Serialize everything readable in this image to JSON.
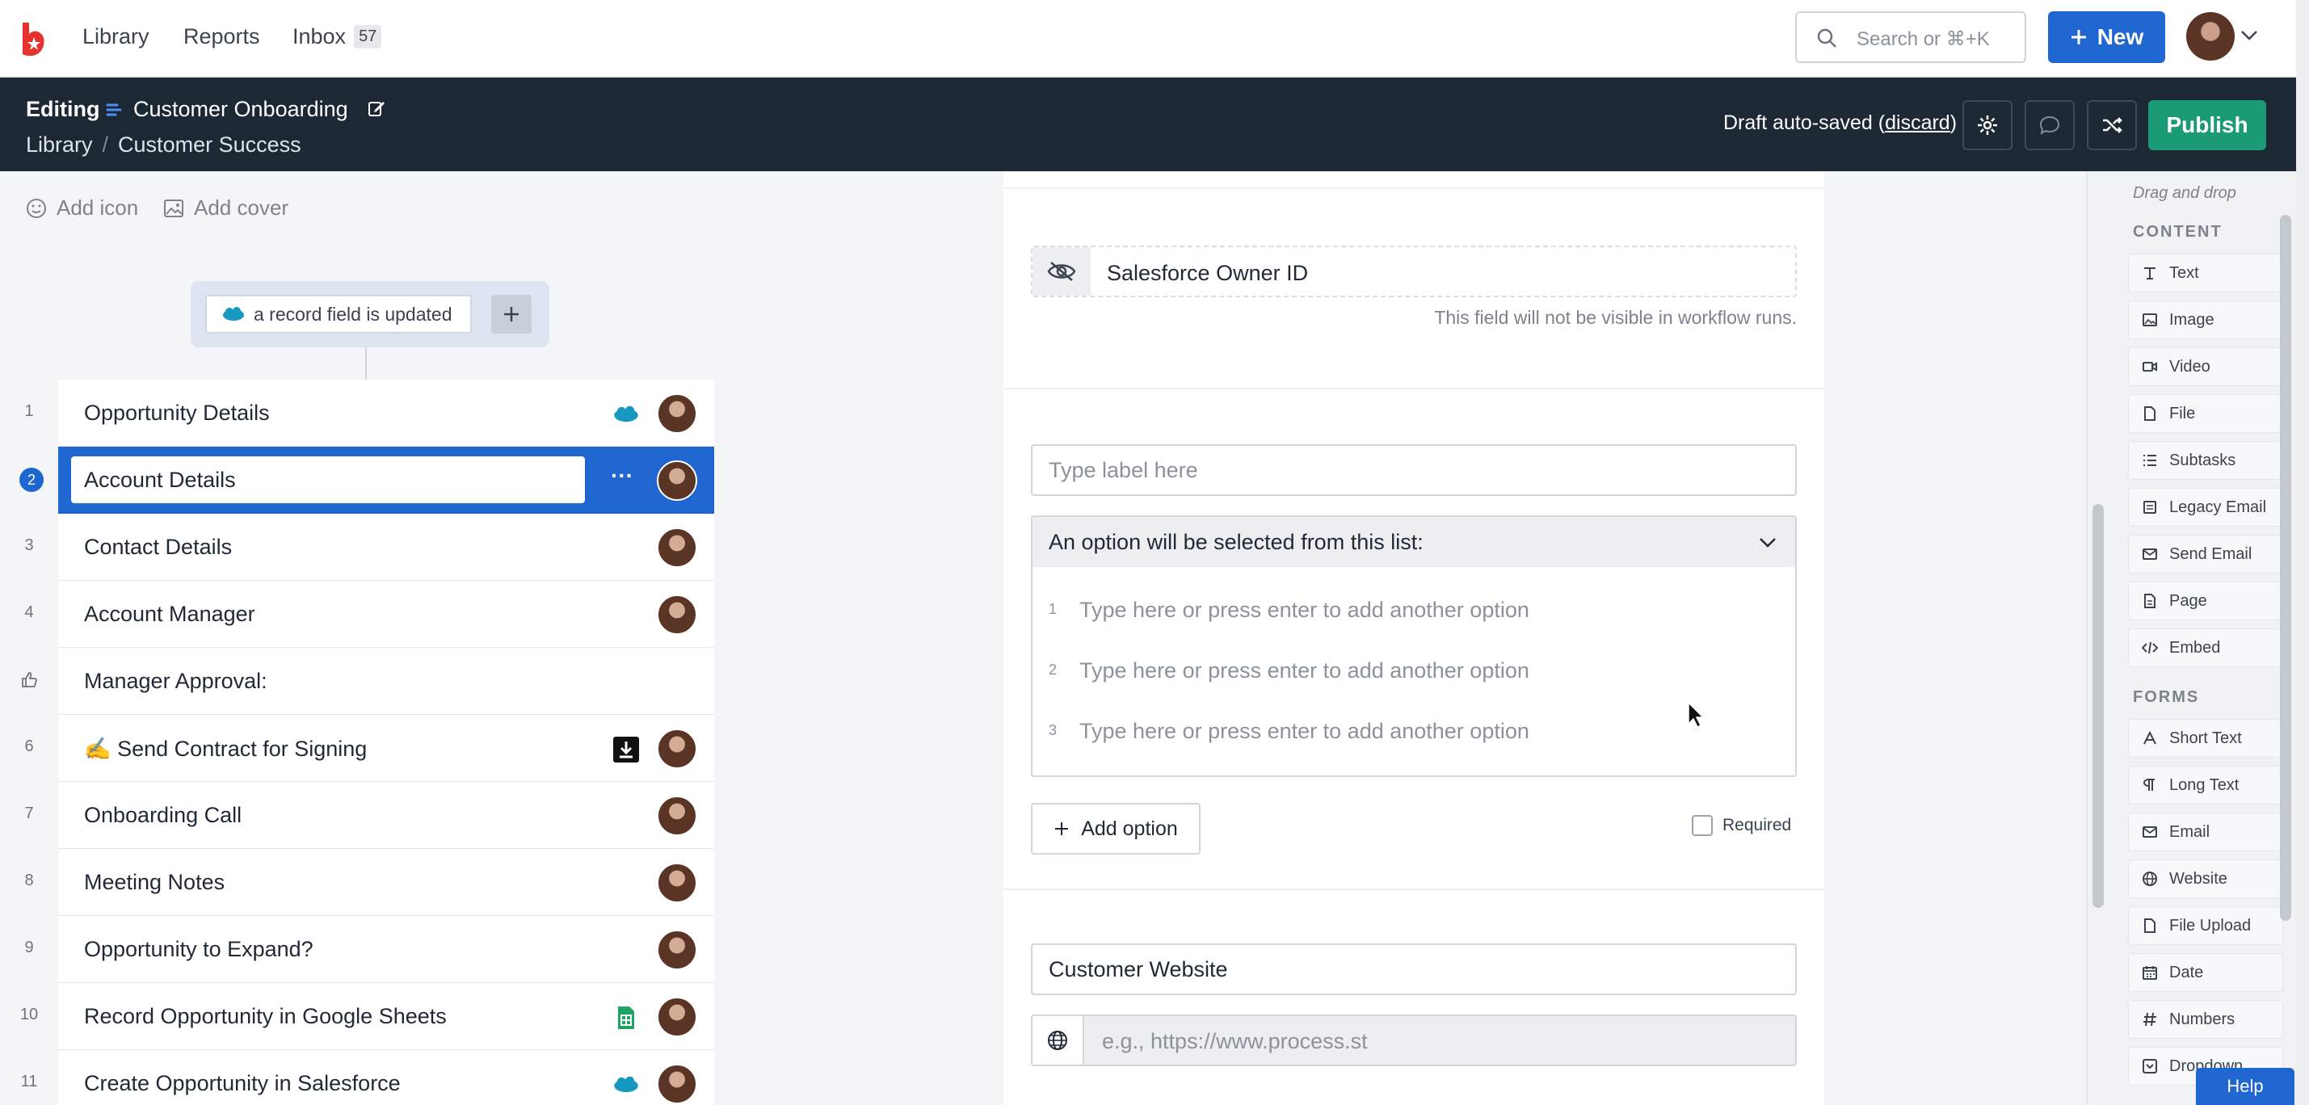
{
  "nav": {
    "links": [
      "Library",
      "Reports",
      "Inbox"
    ],
    "inbox_count": "57",
    "search_placeholder": "Search or ⌘+K",
    "new_label": "New"
  },
  "editbar": {
    "mode": "Editing",
    "title": "Customer Onboarding",
    "breadcrumb": [
      "Library",
      "Customer Success"
    ],
    "draft_text": "Draft auto-saved",
    "discard_label": "discard",
    "publish_label": "Publish"
  },
  "left": {
    "add_icon": "Add icon",
    "add_cover": "Add cover",
    "trigger": "a record field is updated",
    "tasks": [
      {
        "num": "1",
        "label": "Opportunity Details",
        "badge": "salesforce"
      },
      {
        "num": "2",
        "label": "Account Details",
        "selected": true
      },
      {
        "num": "3",
        "label": "Contact Details"
      },
      {
        "num": "4",
        "label": "Account Manager"
      },
      {
        "num": "",
        "label": "Manager Approval:",
        "icon": "thumbs-up"
      },
      {
        "num": "6",
        "label": "✍️ Send Contract for Signing",
        "badge": "download"
      },
      {
        "num": "7",
        "label": "Onboarding Call"
      },
      {
        "num": "8",
        "label": "Meeting Notes"
      },
      {
        "num": "9",
        "label": "Opportunity to Expand?"
      },
      {
        "num": "10",
        "label": "Record Opportunity in Google Sheets",
        "badge": "sheets"
      },
      {
        "num": "11",
        "label": "Create Opportunity in Salesforce",
        "badge": "salesforce"
      }
    ]
  },
  "editor": {
    "hidden_field_value": "Salesforce Owner ID",
    "hidden_hint": "This field will not be visible in workflow runs.",
    "label_placeholder": "Type label here",
    "select_header": "An option will be selected from this list:",
    "option_placeholder": "Type here or press enter to add another option",
    "options": [
      "1",
      "2",
      "3"
    ],
    "add_option": "Add option",
    "required_label": "Required",
    "website_label": "Customer Website",
    "url_placeholder": "e.g., https://www.process.st"
  },
  "sidebar": {
    "hint": "Drag and drop",
    "content_title": "CONTENT",
    "content": [
      {
        "label": "Text",
        "icon": "text-icon"
      },
      {
        "label": "Image",
        "icon": "image-icon"
      },
      {
        "label": "Video",
        "icon": "video-icon"
      },
      {
        "label": "File",
        "icon": "file-icon"
      },
      {
        "label": "Subtasks",
        "icon": "list-icon"
      },
      {
        "label": "Legacy Email",
        "icon": "legacy-email-icon"
      },
      {
        "label": "Send Email",
        "icon": "mail-icon"
      },
      {
        "label": "Page",
        "icon": "page-icon"
      },
      {
        "label": "Embed",
        "icon": "code-icon"
      }
    ],
    "forms_title": "FORMS",
    "forms": [
      {
        "label": "Short Text",
        "icon": "short-text-icon"
      },
      {
        "label": "Long Text",
        "icon": "paragraph-icon"
      },
      {
        "label": "Email",
        "icon": "mail-icon"
      },
      {
        "label": "Website",
        "icon": "globe-icon"
      },
      {
        "label": "File Upload",
        "icon": "file-icon"
      },
      {
        "label": "Date",
        "icon": "calendar-icon"
      },
      {
        "label": "Numbers",
        "icon": "numbers-icon"
      },
      {
        "label": "Dropdown",
        "icon": "dropdown-icon"
      }
    ],
    "help_label": "Help"
  },
  "colors": {
    "accent": "#1f66d1",
    "publish": "#1b9a76",
    "editbar": "#1c2833"
  }
}
